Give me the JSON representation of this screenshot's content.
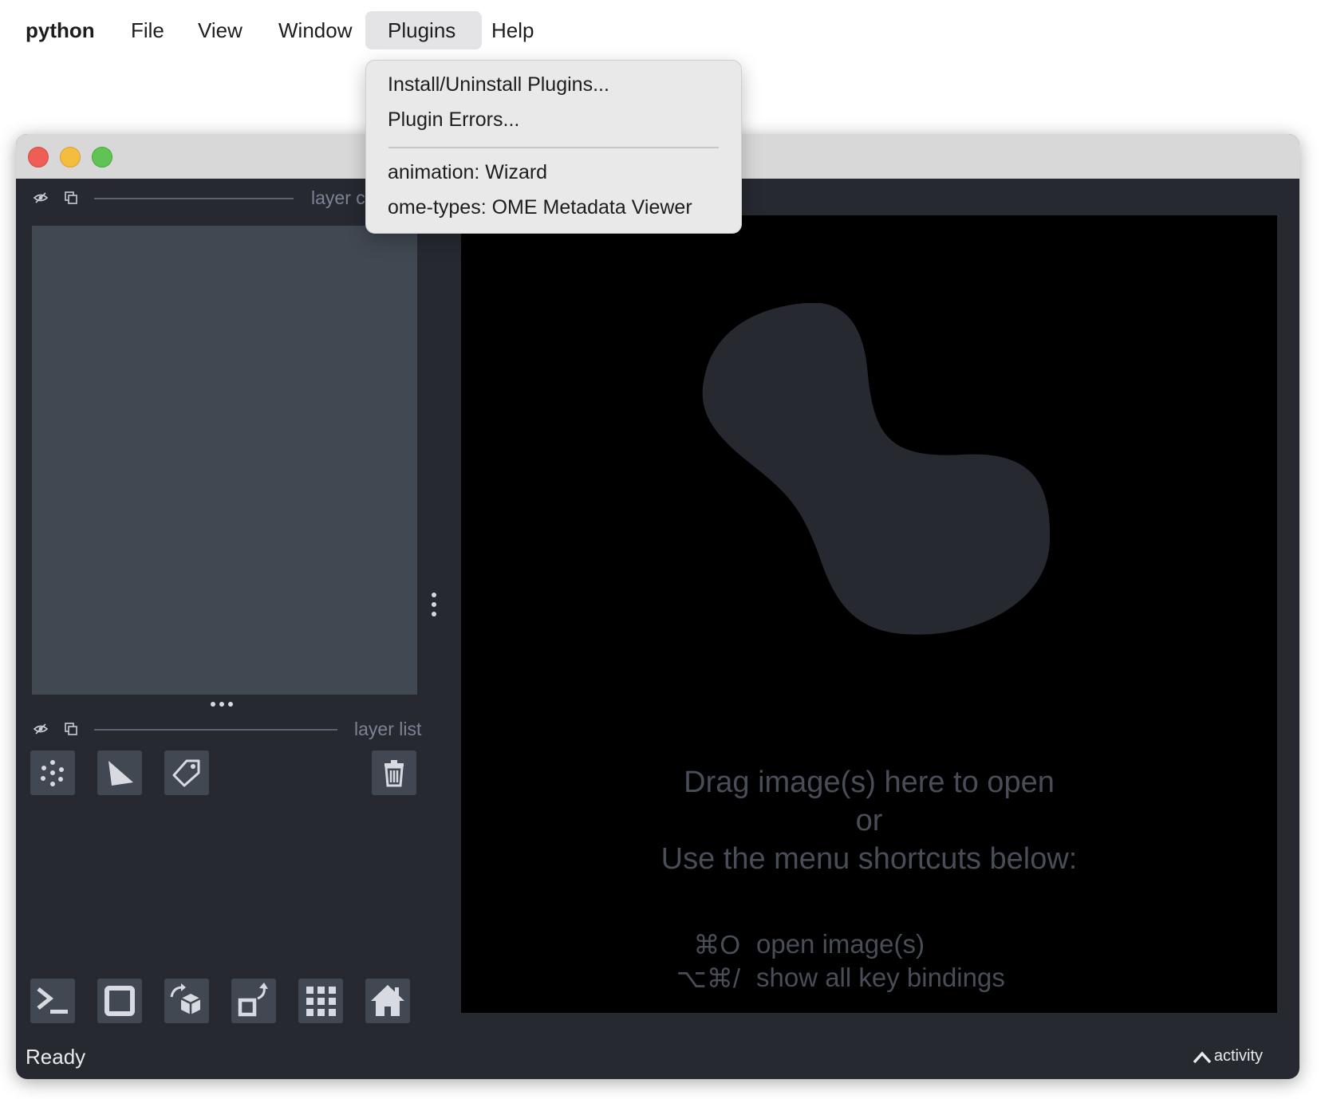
{
  "menubar": {
    "app": "python",
    "items": [
      "File",
      "View",
      "Window",
      "Plugins",
      "Help"
    ],
    "active": "Plugins"
  },
  "plugins_menu": {
    "items": [
      "Install/Uninstall Plugins...",
      "Plugin Errors...",
      "animation: Wizard",
      "ome-types: OME Metadata Viewer"
    ]
  },
  "window": {
    "layer_controls_title": "layer controls",
    "layer_list_title": "layer list",
    "layer_buttons": [
      "new-points-icon",
      "new-shapes-icon",
      "new-labels-icon",
      "delete-layer-icon"
    ],
    "viewer_buttons": [
      "console-icon",
      "ndisplay-icon",
      "roll-icon",
      "transpose-icon",
      "grid-icon",
      "home-icon"
    ],
    "welcome": {
      "line1": "Drag image(s) here to open",
      "line2": "or",
      "line3": "Use the menu shortcuts below:",
      "shortcuts": [
        {
          "key": "⌘O",
          "desc": "open image(s)"
        },
        {
          "key": "⌥⌘/",
          "desc": "show all key bindings"
        }
      ]
    },
    "status": "Ready",
    "activity": "activity",
    "colors": {
      "background": "#262930",
      "panel": "#414851",
      "canvas": "#000000",
      "text_dim": "#494d57"
    }
  }
}
